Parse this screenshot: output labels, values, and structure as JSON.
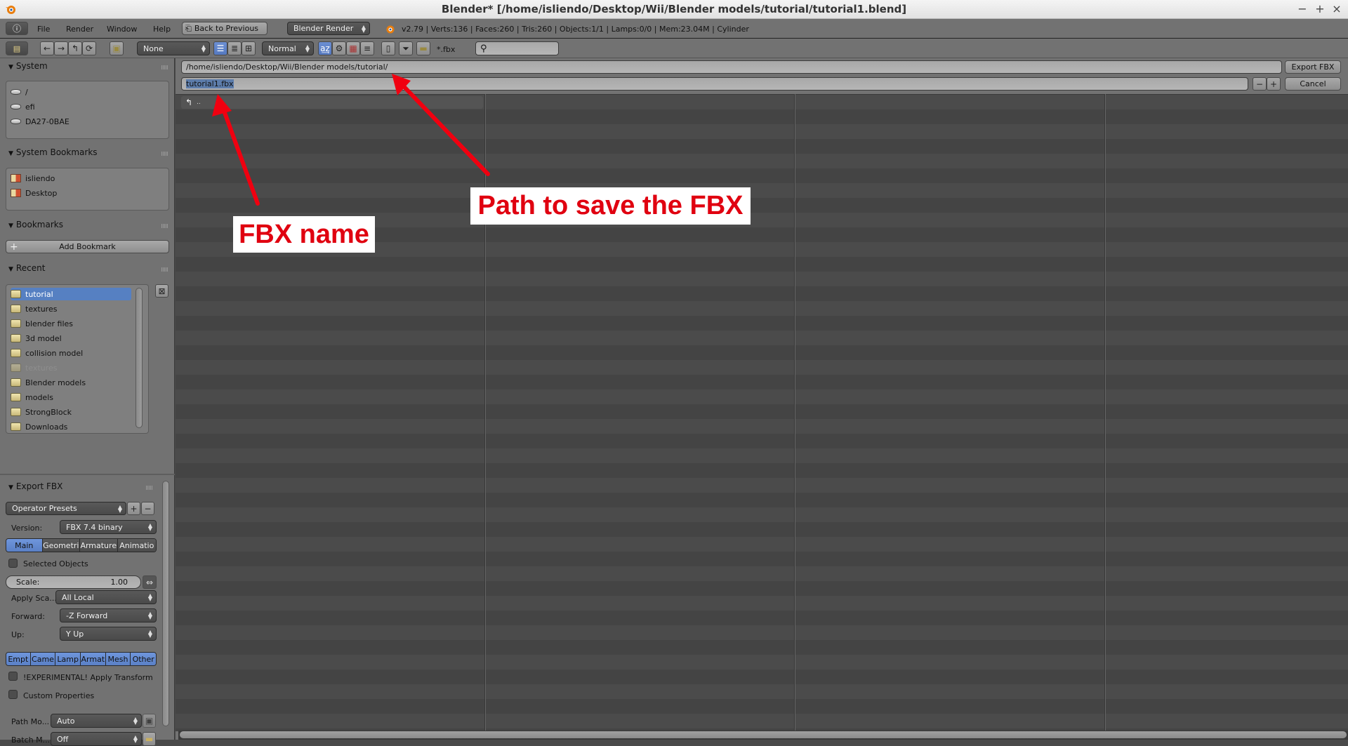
{
  "window": {
    "title": "Blender* [/home/isliendo/Desktop/Wii/Blender models/tutorial/tutorial1.blend]",
    "controls": [
      "minimize",
      "maximize",
      "close"
    ]
  },
  "info_header": {
    "menus": [
      "File",
      "Render",
      "Window",
      "Help"
    ],
    "back_button": "Back to Previous",
    "render_engine": "Blender Render",
    "stats": "v2.79 | Verts:136 | Faces:260 | Tris:260 | Objects:1/1 | Lamps:0/0 | Mem:23.04M | Cylinder"
  },
  "toolbar": {
    "recursion": "None",
    "sort": "Normal",
    "filter_glob": "*.fbx",
    "search_placeholder": ""
  },
  "file_browser": {
    "directory": "/home/isliendo/Desktop/Wii/Blender models/tutorial/",
    "filename": "tutorial1.fbx",
    "export_button": "Export FBX",
    "cancel_button": "Cancel",
    "parent_entry": ".."
  },
  "sidebar": {
    "system": {
      "label": "System",
      "items": [
        "/",
        "efi",
        "DA27-0BAE"
      ]
    },
    "system_bookmarks": {
      "label": "System Bookmarks",
      "items": [
        "isliendo",
        "Desktop"
      ]
    },
    "bookmarks": {
      "label": "Bookmarks",
      "add_button": "Add Bookmark"
    },
    "recent": {
      "label": "Recent",
      "items": [
        {
          "label": "tutorial",
          "selected": true,
          "dim": false
        },
        {
          "label": "textures",
          "selected": false,
          "dim": false
        },
        {
          "label": "blender files",
          "selected": false,
          "dim": false
        },
        {
          "label": "3d model",
          "selected": false,
          "dim": false
        },
        {
          "label": "collision model",
          "selected": false,
          "dim": false
        },
        {
          "label": "textures",
          "selected": false,
          "dim": true
        },
        {
          "label": "Blender models",
          "selected": false,
          "dim": false
        },
        {
          "label": "models",
          "selected": false,
          "dim": false
        },
        {
          "label": "StrongBlock",
          "selected": false,
          "dim": false
        },
        {
          "label": "Downloads",
          "selected": false,
          "dim": false
        }
      ]
    }
  },
  "export_fbx": {
    "label": "Export FBX",
    "operator_presets": "Operator Presets",
    "version_label": "Version:",
    "version_value": "FBX 7.4 binary",
    "tabs": [
      "Main",
      "Geometri",
      "Armature",
      "Animatio"
    ],
    "active_tab": "Main",
    "selected_objects_label": "Selected Objects",
    "selected_objects_checked": false,
    "scale_label": "Scale:",
    "scale_value": "1.00",
    "apply_scale_label": "Apply Sca...",
    "apply_scale_value": "All Local",
    "forward_label": "Forward:",
    "forward_value": "-Z Forward",
    "up_label": "Up:",
    "up_value": "Y Up",
    "object_types": [
      "Empt",
      "Came",
      "Lamp",
      "Armat",
      "Mesh",
      "Other"
    ],
    "apply_transform_label": "!EXPERIMENTAL! Apply Transform",
    "apply_transform_checked": false,
    "custom_props_label": "Custom Properties",
    "custom_props_checked": false,
    "path_mode_label": "Path Mo...",
    "path_mode_value": "Auto",
    "batch_mode_label": "Batch M...",
    "batch_mode_value": "Off"
  },
  "annotations": {
    "fbx_name": "FBX name",
    "path_to_save": "Path to save the FBX",
    "color": "#e00010"
  }
}
